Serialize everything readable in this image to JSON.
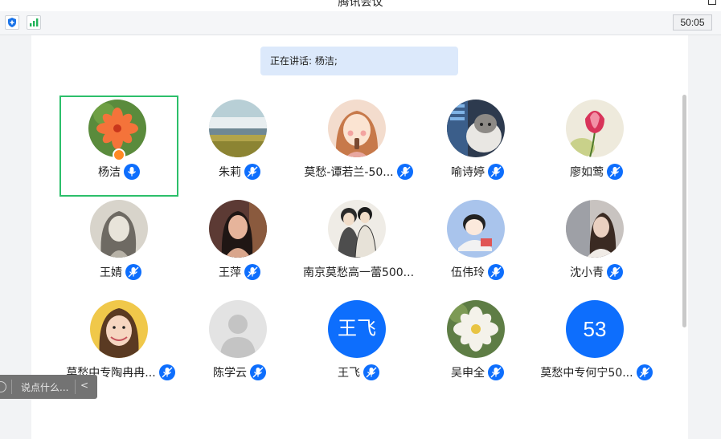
{
  "window": {
    "title": "腾讯会议"
  },
  "toolbar": {
    "timer": "50:05",
    "shield_icon": "shield-icon",
    "signal_icon": "signal-icon"
  },
  "speaking": {
    "label": "正在讲话: 杨洁;"
  },
  "colors": {
    "active_border": "#2cbf6a",
    "mic_blue": "#0d6efd",
    "banner_bg": "#dce9fb",
    "host_badge": "#ff8a25"
  },
  "participants": [
    {
      "name": "杨洁",
      "avatar": "flower-photo",
      "active": true,
      "host": true
    },
    {
      "name": "朱莉",
      "avatar": "landscape-photo"
    },
    {
      "name": "莫愁-谭若兰-50...",
      "avatar": "cartoon-girl"
    },
    {
      "name": "喻诗婷",
      "avatar": "cat-photo"
    },
    {
      "name": "廖如莺",
      "avatar": "tulip-photo"
    },
    {
      "name": "王婧",
      "avatar": "sketch-portrait"
    },
    {
      "name": "王萍",
      "avatar": "woman-photo"
    },
    {
      "name": "南京莫愁高一蕾500...",
      "avatar": "couple-drawing"
    },
    {
      "name": "伍伟玲",
      "avatar": "cartoon-character"
    },
    {
      "name": "沈小青",
      "avatar": "girl-photo"
    },
    {
      "name": "莫愁中专陶冉冉...",
      "avatar": "smiling-girl"
    },
    {
      "name": "陈学云",
      "avatar": "default-avatar"
    },
    {
      "name": "王飞",
      "avatar": "text",
      "avatar_text": "王飞"
    },
    {
      "name": "吴申全",
      "avatar": "white-flower"
    },
    {
      "name": "莫愁中专何宁50...",
      "avatar": "text",
      "avatar_text": "53"
    }
  ],
  "chat": {
    "placeholder": "说点什么...",
    "emoji_icon": "emoji-icon",
    "collapse_icon": "chevron-left-icon",
    "collapse_label": "<"
  }
}
